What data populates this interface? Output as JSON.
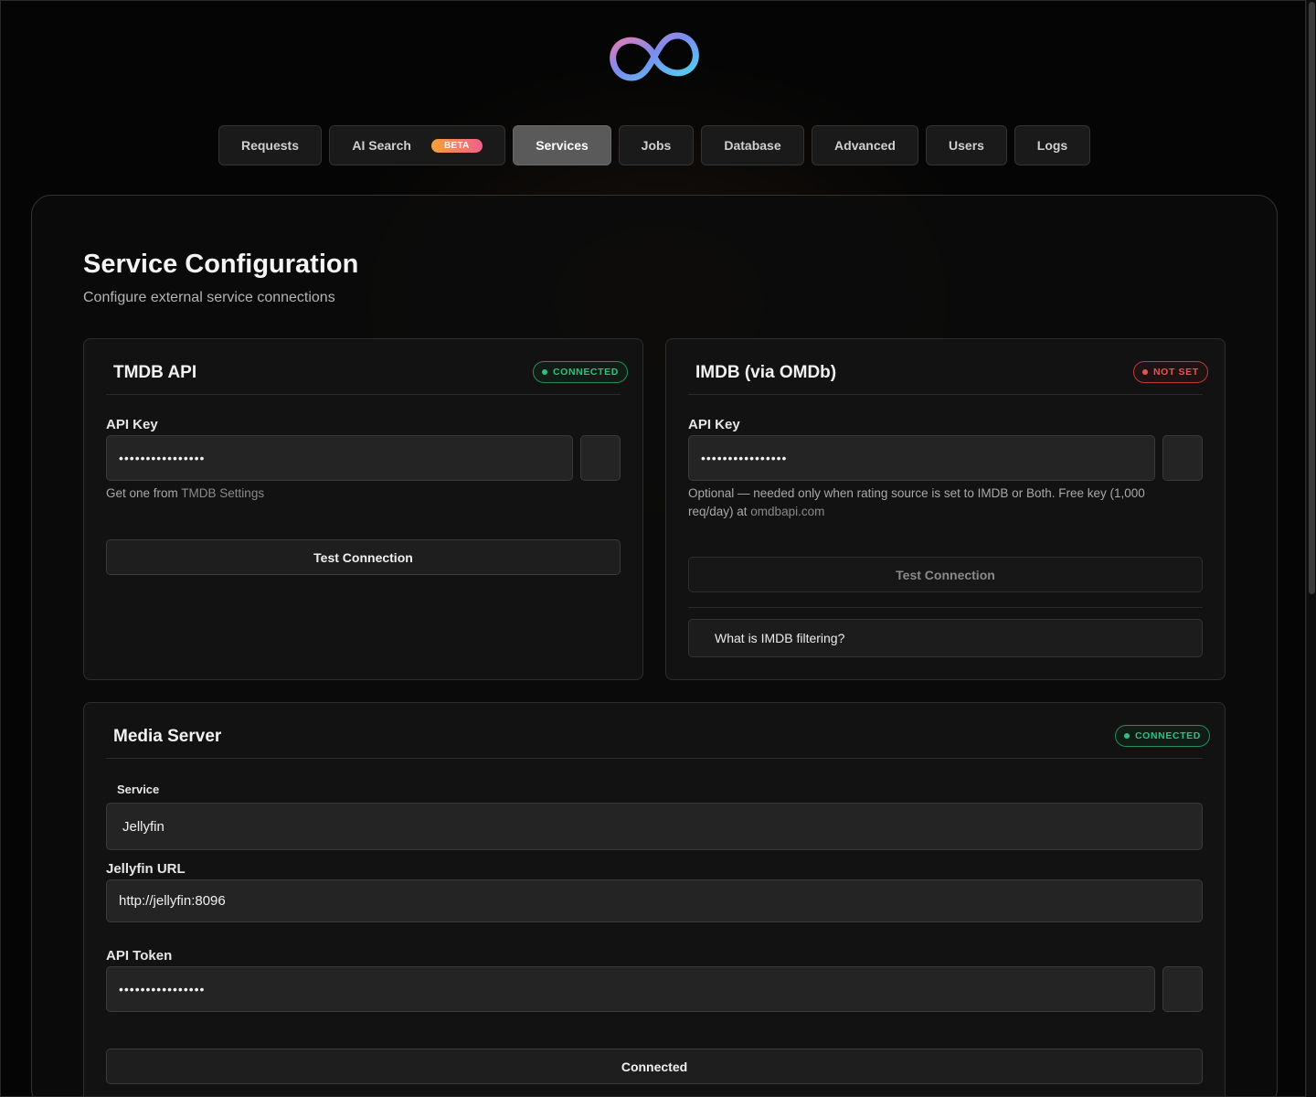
{
  "nav": {
    "tabs": [
      {
        "label": "Requests"
      },
      {
        "label": "AI Search",
        "badge": "BETA"
      },
      {
        "label": "Services",
        "active": true
      },
      {
        "label": "Jobs"
      },
      {
        "label": "Database"
      },
      {
        "label": "Advanced"
      },
      {
        "label": "Users"
      },
      {
        "label": "Logs"
      }
    ]
  },
  "page": {
    "title": "Service Configuration",
    "subtitle": "Configure external service connections"
  },
  "tmdb": {
    "title": "TMDB API",
    "status": "CONNECTED",
    "api_key_label": "API Key",
    "api_key_value": "••••••••••••••••",
    "hint_prefix": "Get one from ",
    "hint_link": "TMDB Settings",
    "test_button": "Test Connection"
  },
  "imdb": {
    "title": "IMDB (via OMDb)",
    "status": "NOT SET",
    "api_key_label": "API Key",
    "api_key_value": "••••••••••••••••",
    "hint_line1": "Optional — needed only when rating source is set to IMDB or Both. Free key (1,000",
    "hint_line2_prefix": "req/day) at ",
    "hint_link": "omdbapi.com",
    "test_button": "Test Connection",
    "expander_label": "What is IMDB filtering?"
  },
  "media_server": {
    "title": "Media Server",
    "status": "CONNECTED",
    "service_label": "Service",
    "service_value": "Jellyfin",
    "url_label": "Jellyfin URL",
    "url_value": "http://jellyfin:8096",
    "token_label": "API Token",
    "token_value": "••••••••••••••••",
    "button": "Connected"
  },
  "colors": {
    "accent_ok": "#2fc07f",
    "accent_bad": "#e05656",
    "beta_gradient_start": "#f2a13b",
    "beta_gradient_end": "#f0608a",
    "logo_gradient": [
      "#f07ab0",
      "#7a8cf0",
      "#4fd6f0"
    ]
  }
}
